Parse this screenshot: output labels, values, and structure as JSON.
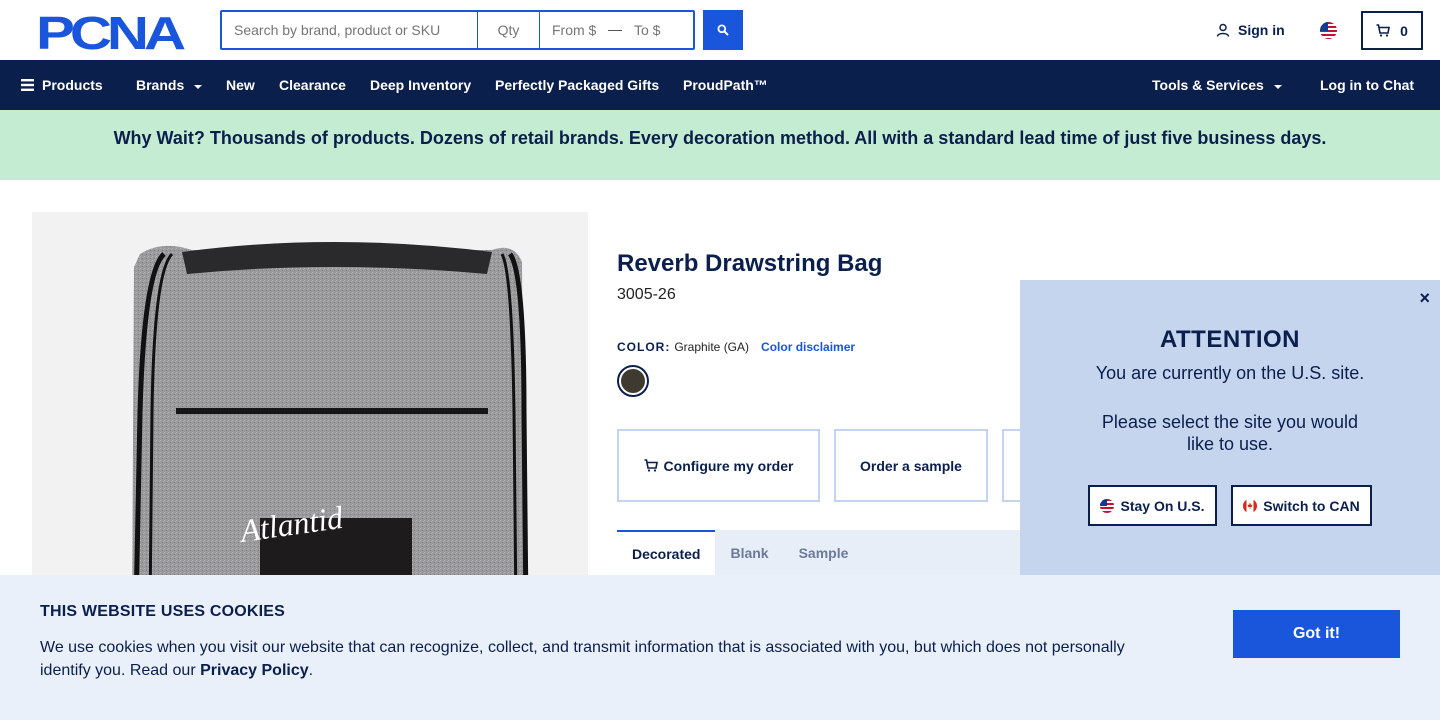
{
  "header": {
    "logo_text": "PCNA",
    "search": {
      "placeholder": "Search by brand, product or SKU",
      "qty_placeholder": "Qty",
      "from_placeholder": "From $",
      "to_placeholder": "To $"
    },
    "sign_in": "Sign in",
    "cart_count": "0"
  },
  "nav": {
    "products": "Products",
    "brands": "Brands",
    "new": "New",
    "clearance": "Clearance",
    "deep_inventory": "Deep Inventory",
    "gifts": "Perfectly Packaged Gifts",
    "proudpath": "ProudPath™",
    "tools": "Tools & Services",
    "chat": "Log in to Chat"
  },
  "banner": {
    "text": "Why Wait? Thousands of products. Dozens of retail brands. Every decoration method. All with a standard lead time of just five business days."
  },
  "product": {
    "title": "Reverb Drawstring Bag",
    "sku": "3005-26",
    "color_label": "COLOR:",
    "color_value": "Graphite (GA)",
    "color_disclaimer": "Color disclaimer",
    "swatch_color": "#3e3a2f",
    "image_print_text": "Atlantid",
    "actions": {
      "configure": "Configure my order",
      "sample": "Order a sample"
    },
    "tabs": [
      "Decorated",
      "Blank",
      "Sample"
    ]
  },
  "popup": {
    "title": "ATTENTION",
    "message": "You are currently on the U.S. site.",
    "message2": "Please select the site you would like to use.",
    "stay": "Stay On U.S.",
    "switch": "Switch to CAN",
    "close": "×"
  },
  "cookie": {
    "title": "THIS WEBSITE USES COOKIES",
    "text": "We use cookies when you visit our website that can recognize, collect, and transmit information that is associated with you, but which does not personally identify you. Read our",
    "link": "Privacy Policy",
    "period": ".",
    "button": "Got it!"
  },
  "colors": {
    "navy": "#0b1f4d",
    "blue": "#1a56db",
    "banner_green": "#c4ecd3",
    "popup_bg": "#c5d5ee",
    "cookie_bg": "#e9f0fa"
  }
}
